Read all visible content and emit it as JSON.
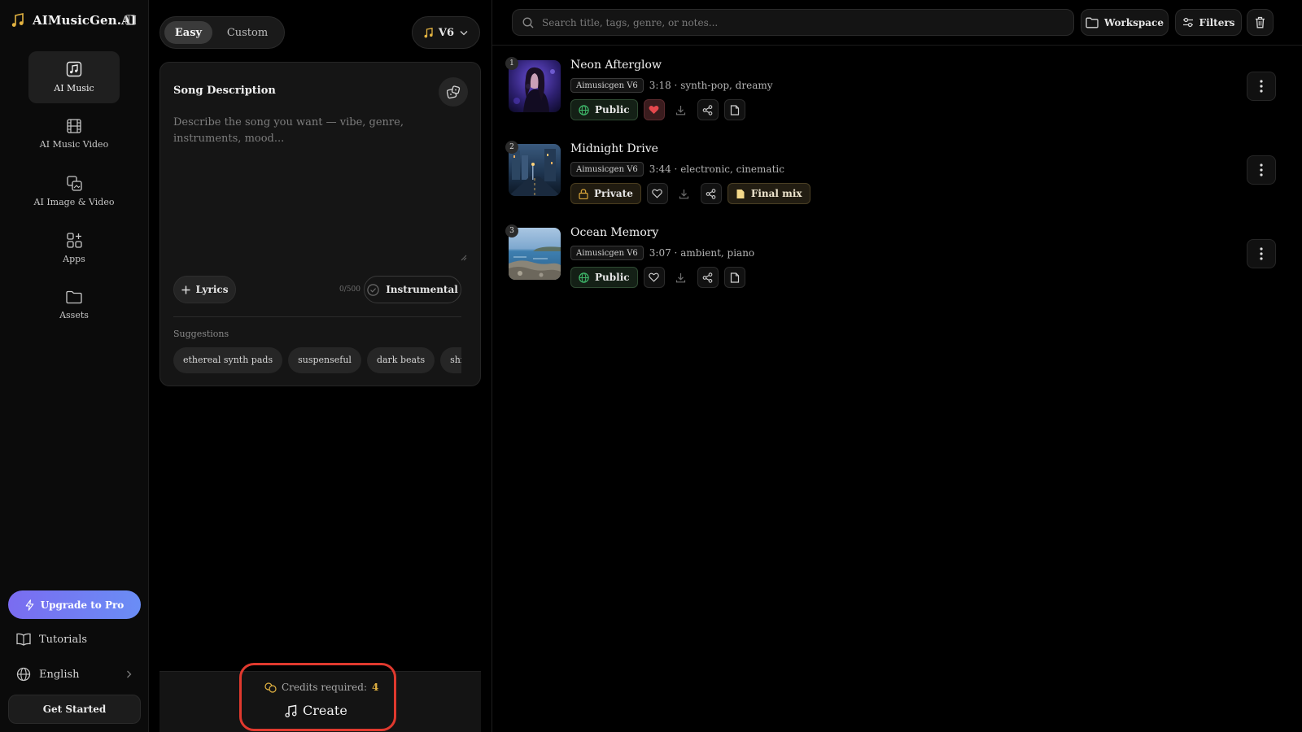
{
  "app": {
    "name": "AIMusicGen.AI"
  },
  "sidebar": {
    "items": [
      {
        "label": "AI Music",
        "icon": "music-note-icon"
      },
      {
        "label": "AI Music Video",
        "icon": "film-icon"
      },
      {
        "label": "AI Image & Video",
        "icon": "image-copy-icon"
      },
      {
        "label": "Apps",
        "icon": "apps-grid-icon"
      },
      {
        "label": "Assets",
        "icon": "folder-icon"
      }
    ],
    "upgrade_label": "Upgrade to Pro",
    "tutorials_label": "Tutorials",
    "language_label": "English",
    "get_started_label": "Get Started"
  },
  "composer": {
    "mode_easy": "Easy",
    "mode_custom": "Custom",
    "version_label": "V6",
    "card_title": "Song Description",
    "description_placeholder": "Describe the song you want — vibe, genre, instruments, mood...",
    "lyrics_label": "Lyrics",
    "char_count": "0/500",
    "instrumental_label": "Instrumental",
    "suggestions_label": "Suggestions",
    "suggestions": [
      "ethereal synth pads",
      "suspenseful",
      "dark beats",
      "shimm"
    ],
    "credits_label": "Credits required:",
    "credits_value": "4",
    "create_label": "Create"
  },
  "library": {
    "search_placeholder": "Search title, tags, genre, or notes...",
    "workspace_label": "Workspace",
    "filters_label": "Filters",
    "tracks": [
      {
        "index": "1",
        "title": "Neon Afterglow",
        "model": "Aimusicgen V6",
        "meta": "3:18 · synth-pop, dreamy",
        "visibility": "Public",
        "liked": true,
        "note": ""
      },
      {
        "index": "2",
        "title": "Midnight Drive",
        "model": "Aimusicgen V6",
        "meta": "3:44 · electronic, cinematic",
        "visibility": "Private",
        "liked": false,
        "note": "Final mix"
      },
      {
        "index": "3",
        "title": "Ocean Memory",
        "model": "Aimusicgen V6",
        "meta": "3:07 · ambient, piano",
        "visibility": "Public",
        "liked": false,
        "note": ""
      }
    ]
  },
  "colors": {
    "accent_gradient_start": "#7a6cf0",
    "accent_gradient_end": "#6a8df5",
    "highlight_ring": "#e0392e",
    "like_red": "#e5484d",
    "credits_gold": "#e3b341",
    "public_green": "#3fb96b",
    "private_gold": "#d9a53a"
  }
}
